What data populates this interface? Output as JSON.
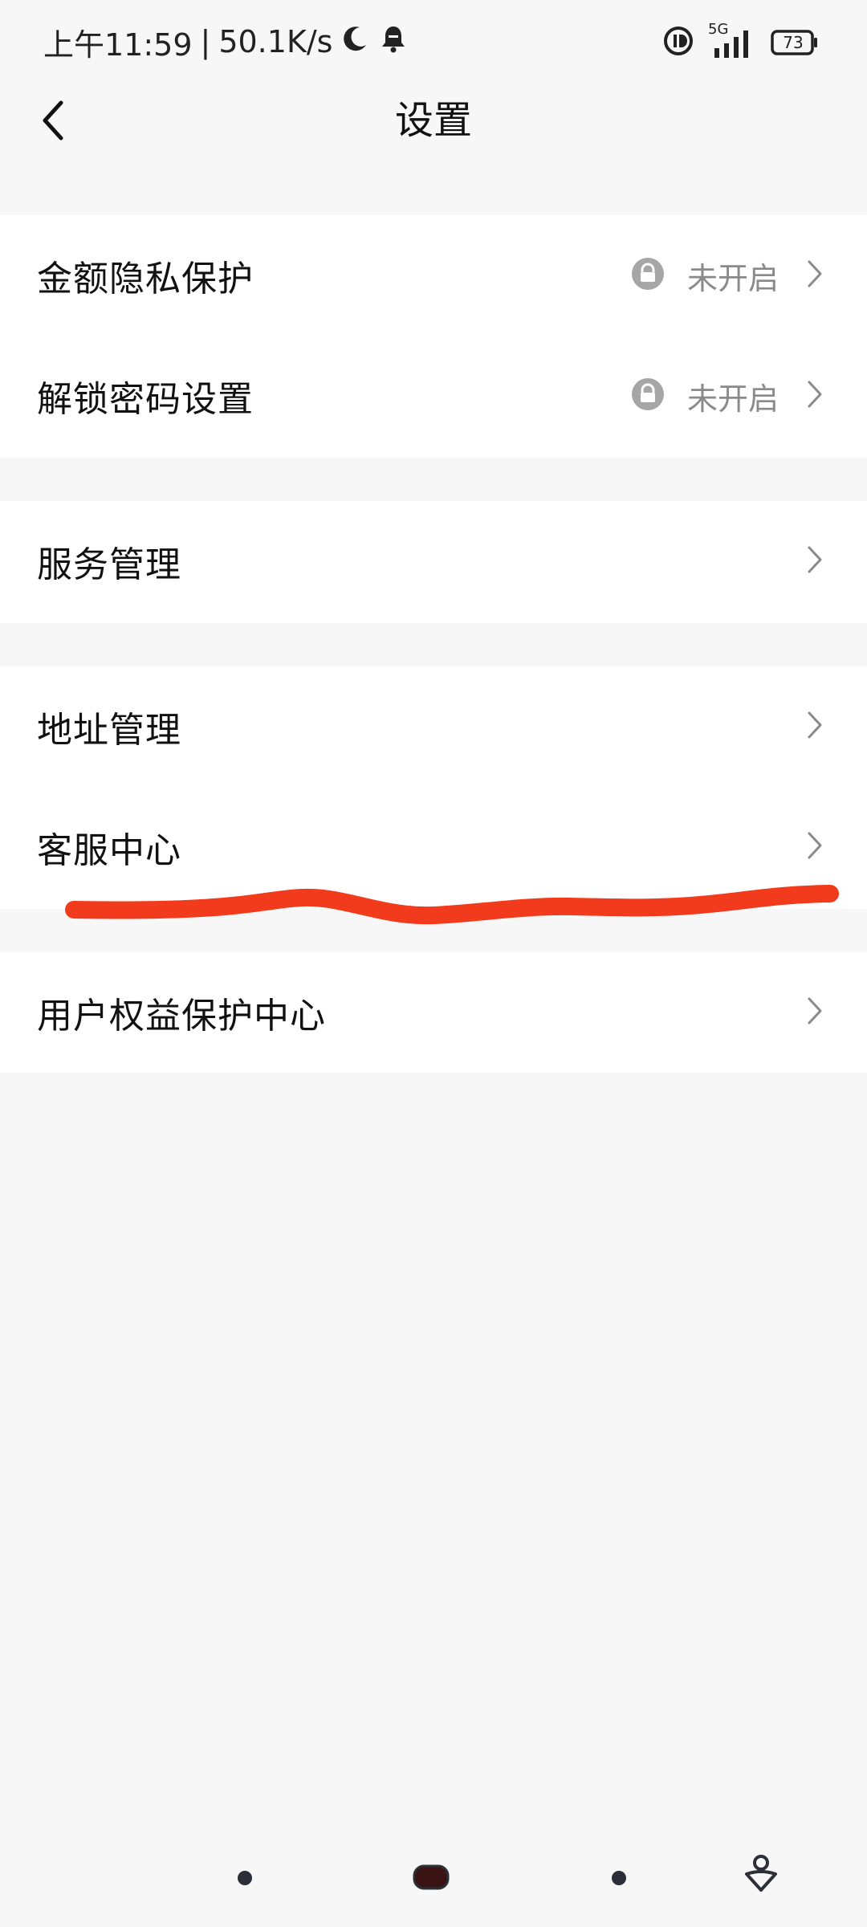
{
  "status_bar": {
    "time": "上午11:59",
    "separator": "|",
    "speed": "50.1K/s",
    "network": "5G",
    "battery": "73"
  },
  "header": {
    "title": "设置"
  },
  "groups": [
    {
      "items": [
        {
          "label": "金额隐私保护",
          "status": "未开启"
        },
        {
          "label": "解锁密码设置",
          "status": "未开启"
        }
      ]
    },
    {
      "items": [
        {
          "label": "服务管理"
        }
      ]
    },
    {
      "items": [
        {
          "label": "地址管理"
        },
        {
          "label": "客服中心"
        }
      ]
    },
    {
      "items": [
        {
          "label": "用户权益保护中心"
        }
      ]
    }
  ],
  "colors": {
    "annotation_stroke": "#f23a1c",
    "background": "#f7f7f7",
    "secondary_text": "#8a8a8a"
  }
}
